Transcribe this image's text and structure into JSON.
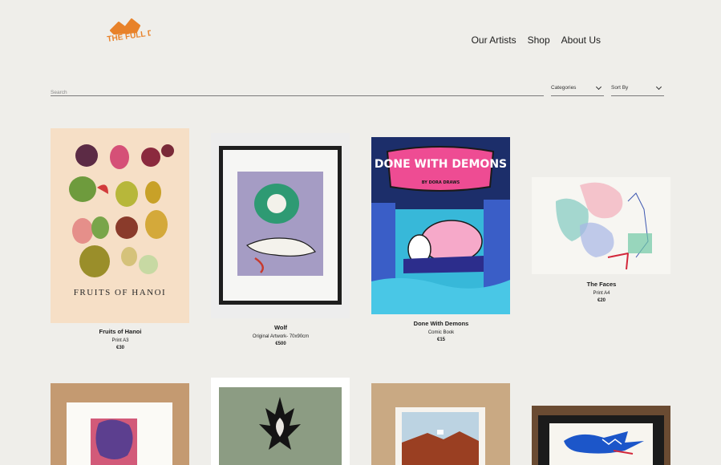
{
  "brand": {
    "logo_text": "THE FULL DRAWER"
  },
  "nav": {
    "items": [
      "Our Artists",
      "Shop",
      "About Us"
    ]
  },
  "filters": {
    "search_placeholder": "Search",
    "categories_label": "Categories",
    "sort_label": "Sort By"
  },
  "products": [
    {
      "title": "Fruits of Hanoi",
      "subtitle": "Print A3",
      "price": "€30",
      "art_text": "FRUITS OF HANOI"
    },
    {
      "title": "Wolf",
      "subtitle": "Original Artwork- 70x90cm",
      "price": "€500"
    },
    {
      "title": "Done With Demons",
      "subtitle": "Comic Book",
      "price": "€15",
      "art_text": "DONE WITH DEMONS",
      "art_sub": "BY DORA DRAWS"
    },
    {
      "title": "The Faces",
      "subtitle": "Print A4",
      "price": "€20"
    }
  ],
  "colors": {
    "background": "#efeeea",
    "brand_orange": "#e8822a"
  }
}
